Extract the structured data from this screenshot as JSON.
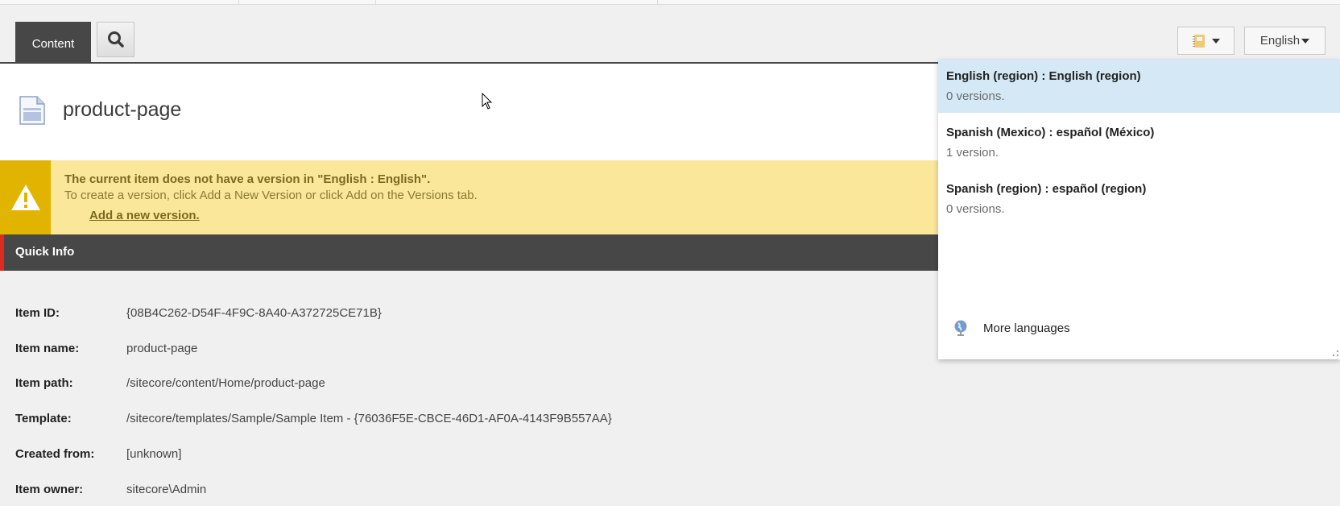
{
  "toolbar": {
    "content_tab_label": "Content",
    "search_button": "search",
    "language_button_label": "English"
  },
  "item": {
    "title": "product-page"
  },
  "warning": {
    "title": "The current item does not have a version in \"English : English\".",
    "text": "To create a version, click Add a New Version or click Add on the Versions tab.",
    "link": "Add a new version."
  },
  "quick_info": {
    "header": "Quick Info",
    "rows": [
      {
        "label": "Item ID:",
        "value": "{08B4C262-D54F-4F9C-8A40-A372725CE71B}"
      },
      {
        "label": "Item name:",
        "value": "product-page"
      },
      {
        "label": "Item path:",
        "value": "/sitecore/content/Home/product-page"
      },
      {
        "label": "Template:",
        "value": "/sitecore/templates/Sample/Sample Item - {76036F5E-CBCE-46D1-AF0A-4143F9B557AA}"
      },
      {
        "label": "Created from:",
        "value": "[unknown]"
      },
      {
        "label": "Item owner:",
        "value": "sitecore\\Admin"
      }
    ]
  },
  "language_dropdown": {
    "items": [
      {
        "name": "English (region) : English (region)",
        "versions": "0 versions.",
        "selected": true
      },
      {
        "name": "Spanish (Mexico) : español (México)",
        "versions": "1 version.",
        "selected": false
      },
      {
        "name": "Spanish (region) : español (region)",
        "versions": "0 versions.",
        "selected": false
      }
    ],
    "more_languages": "More languages"
  },
  "colors": {
    "tab_dark": "#474747",
    "warning_bg": "#fae79a",
    "warning_accent": "#e0b400",
    "quickinfo_accent": "#dd2b1f",
    "dropdown_selected": "#d4e9f5"
  }
}
